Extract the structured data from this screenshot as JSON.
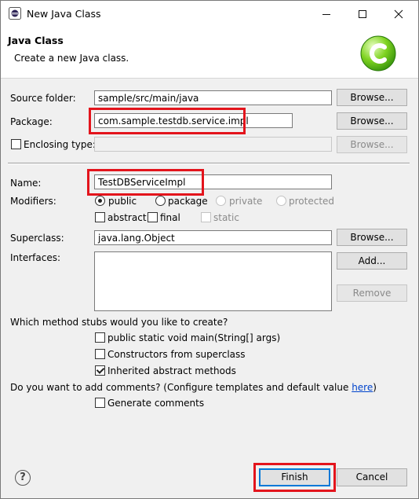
{
  "window": {
    "title": "New Java Class"
  },
  "header": {
    "title": "Java Class",
    "description": "Create a new Java class."
  },
  "source_folder": {
    "label": "Source folder:",
    "value": "sample/src/main/java",
    "browse": "Browse..."
  },
  "package": {
    "label": "Package:",
    "value": "com.sample.testdb.service.impl",
    "browse": "Browse..."
  },
  "enclosing": {
    "label": "Enclosing type:",
    "value": "",
    "browse": "Browse...",
    "checked": false
  },
  "name": {
    "label": "Name:",
    "value": "TestDBServiceImpl"
  },
  "modifiers": {
    "label": "Modifiers:",
    "access": [
      {
        "label": "public",
        "selected": true,
        "enabled": true
      },
      {
        "label": "package",
        "selected": false,
        "enabled": true
      },
      {
        "label": "private",
        "selected": false,
        "enabled": false
      },
      {
        "label": "protected",
        "selected": false,
        "enabled": false
      }
    ],
    "flags": [
      {
        "label": "abstract",
        "checked": false,
        "enabled": true
      },
      {
        "label": "final",
        "checked": false,
        "enabled": true
      },
      {
        "label": "static",
        "checked": false,
        "enabled": false
      }
    ]
  },
  "superclass": {
    "label": "Superclass:",
    "value": "java.lang.Object",
    "browse": "Browse..."
  },
  "interfaces": {
    "label": "Interfaces:",
    "add": "Add...",
    "remove": "Remove"
  },
  "stubs": {
    "question": "Which method stubs would you like to create?",
    "options": [
      {
        "label": "public static void main(String[] args)",
        "checked": false
      },
      {
        "label": "Constructors from superclass",
        "checked": false
      },
      {
        "label": "Inherited abstract methods",
        "checked": true
      }
    ]
  },
  "comments": {
    "question": "Do you want to add comments? (Configure templates and default value ",
    "link": "here",
    "close": ")",
    "option": "Generate comments",
    "checked": false
  },
  "footer": {
    "help": "?",
    "finish": "Finish",
    "cancel": "Cancel"
  },
  "colors": {
    "highlight": "#e3141c",
    "logo": "#6cc417"
  }
}
